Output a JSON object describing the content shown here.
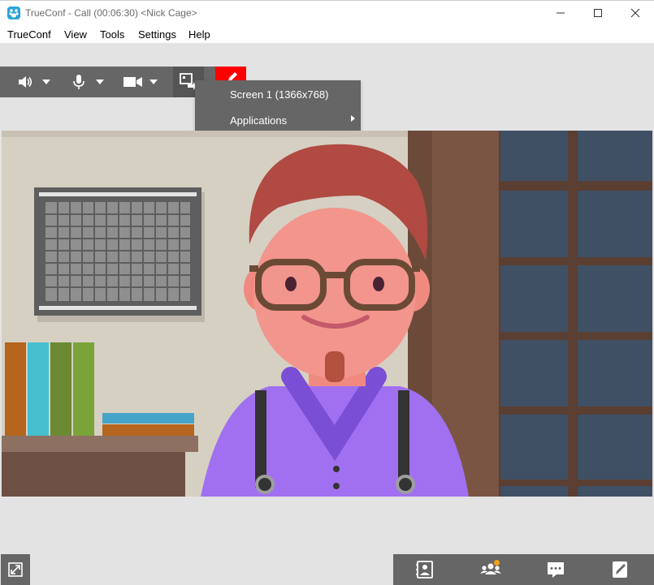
{
  "window": {
    "title": "TrueConf - Call (00:06:30) <Nick Cage>",
    "controls": {
      "minimize_icon": "minimize-icon",
      "maximize_icon": "maximize-icon",
      "close_icon": "close-icon"
    }
  },
  "menu": {
    "items": [
      "TrueConf",
      "View",
      "Tools",
      "Settings",
      "Help"
    ]
  },
  "toolbar": {
    "buttons": [
      "speaker-icon",
      "microphone-icon",
      "camera-icon",
      "screen-share-icon",
      "pen-icon"
    ],
    "share_color": "#ff0000"
  },
  "share_menu": {
    "items": [
      "Screen 1 (1366x768)",
      "Applications"
    ]
  },
  "bottom_bar": {
    "buttons": [
      "contacts-icon",
      "participants-icon",
      "chat-icon",
      "hangup-icon"
    ],
    "fullscreen_icon": "fullscreen-icon",
    "badge_color": "#f7a21b"
  },
  "colors": {
    "toolbar_bg": "#666666",
    "background": "#e3e3e3",
    "accent": "#2aa3d8"
  }
}
